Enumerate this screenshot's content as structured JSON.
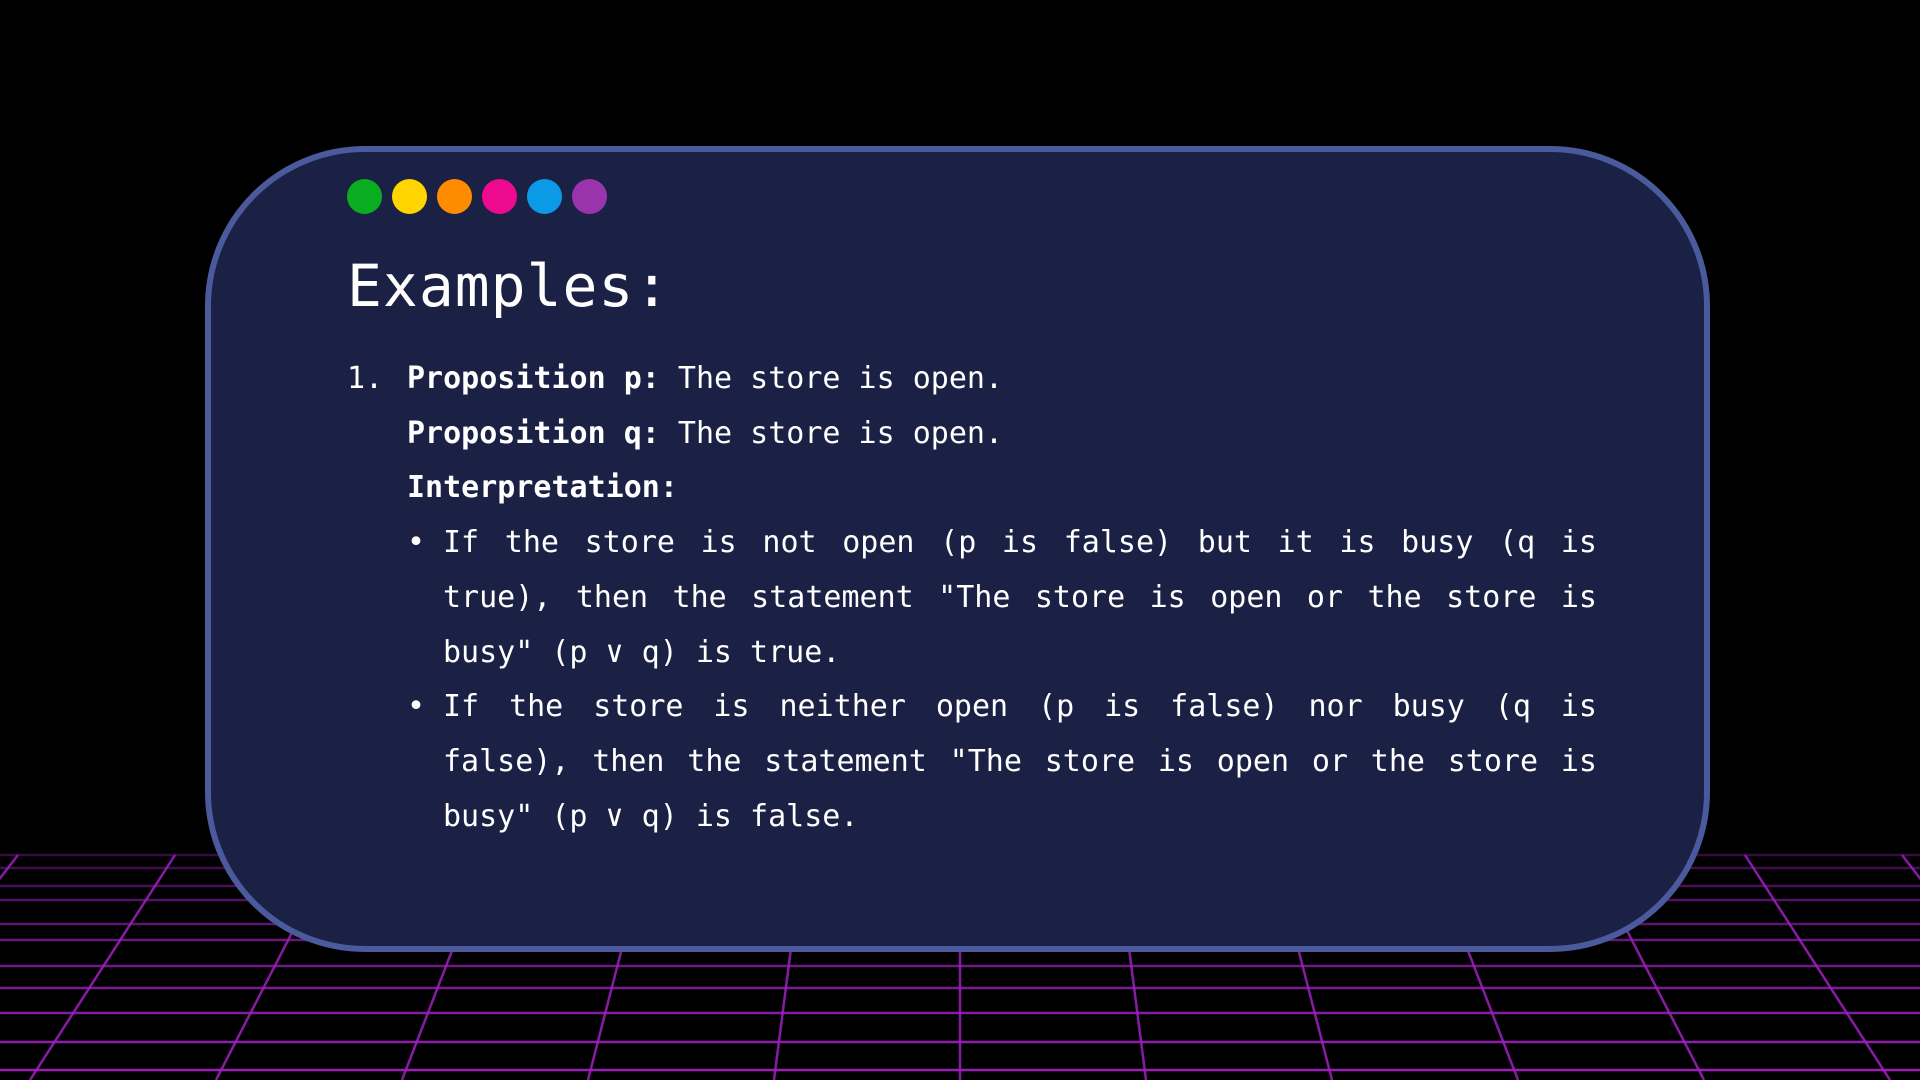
{
  "colors": {
    "background": "#000000",
    "card_fill": "#1b2045",
    "card_border": "#4a5a9c",
    "grid_line": "#a020c0",
    "text": "#ffffff"
  },
  "dots": [
    {
      "name": "green-dot",
      "color": "#0aad1f"
    },
    {
      "name": "yellow-dot",
      "color": "#ffd400"
    },
    {
      "name": "orange-dot",
      "color": "#ff8c00"
    },
    {
      "name": "pink-dot",
      "color": "#ee0a8e"
    },
    {
      "name": "blue-dot",
      "color": "#0a9ae6"
    },
    {
      "name": "purple-dot",
      "color": "#9a34ad"
    }
  ],
  "title": "Examples:",
  "example": {
    "number": "1.",
    "prop_p_label": "Proposition p:",
    "prop_p_text": " The store is open.",
    "prop_q_label": "Proposition q:",
    "prop_q_text": " The store is open.",
    "interpretation_label": "Interpretation:",
    "bullet_symbol": "•",
    "bullets": [
      "If the store is not open (p is false) but it is busy (q is true), then the statement \"The store is open or the store is busy\" (p ∨ q) is true.",
      "If the store is neither open (p is false) nor busy (q is false), then the statement \"The store is open or the store is busy\" (p ∨ q) is false."
    ]
  }
}
